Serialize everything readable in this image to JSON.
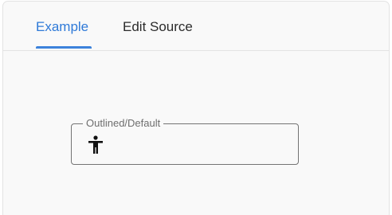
{
  "tabs": [
    {
      "label": "Example",
      "selected": true
    },
    {
      "label": "Edit Source",
      "selected": false
    }
  ],
  "field": {
    "variant": "Outlined",
    "label": "Outlined/Default",
    "value": "",
    "icon": "accessibility-icon"
  },
  "colors": {
    "accent": "#2f7ad8",
    "indicator": "#3c82db",
    "panel_background": "#f9f9f9",
    "field_border": "#737373",
    "label_text": "#6e6e6e"
  }
}
